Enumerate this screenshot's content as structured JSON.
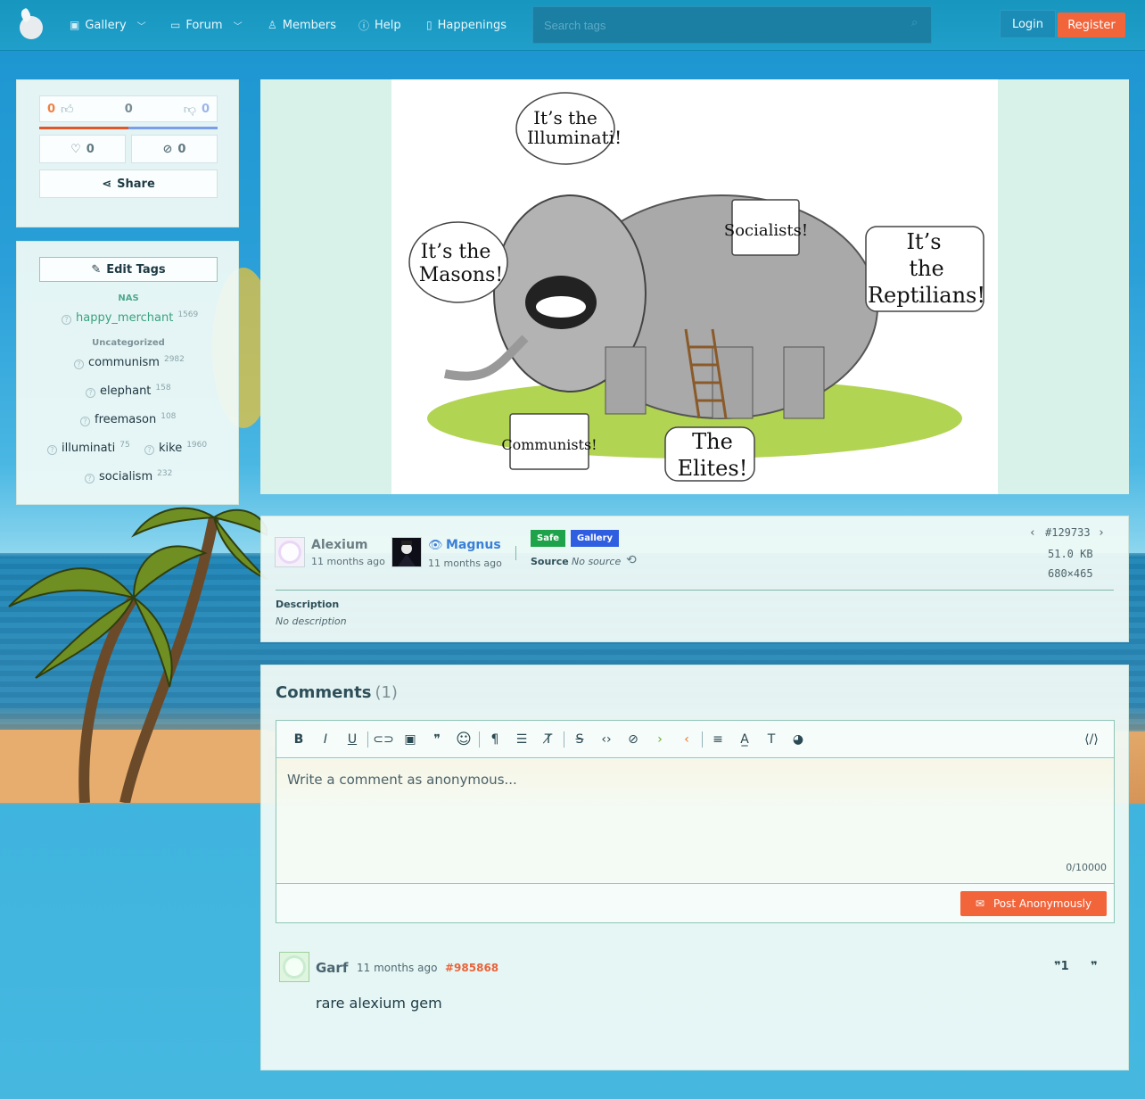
{
  "nav": {
    "logo_icon": "onion-logo-icon",
    "items": [
      {
        "label": "Gallery",
        "icon": "image-icon"
      },
      {
        "label": "Forum",
        "icon": "chat-icon"
      },
      {
        "label": "Members",
        "icon": "user-icon"
      },
      {
        "label": "Help",
        "icon": "question-icon"
      },
      {
        "label": "Happenings",
        "icon": "book-icon"
      }
    ],
    "search_placeholder": "Search tags",
    "login_label": "Login",
    "register_label": "Register",
    "accent_color": "#f2643a"
  },
  "votes": {
    "upvotes": "0",
    "score": "0",
    "downvotes": "0",
    "favorites": "0",
    "hides": "0",
    "share_label": "Share"
  },
  "tags": {
    "edit_label": "Edit Tags",
    "categories": [
      {
        "label": "NAS",
        "items": [
          {
            "name": "happy_merchant",
            "count": "1569"
          }
        ]
      },
      {
        "label": "Uncategorized",
        "items": [
          {
            "name": "communism",
            "count": "2982"
          },
          {
            "name": "elephant",
            "count": "158"
          },
          {
            "name": "freemason",
            "count": "108"
          },
          {
            "name": "illuminati",
            "count": "75"
          },
          {
            "name": "kike",
            "count": "1960"
          },
          {
            "name": "socialism",
            "count": "232"
          }
        ]
      }
    ]
  },
  "image": {
    "bubbles": {
      "illuminati": "It’s the\nIlluminati!",
      "socialists": "Socialists!",
      "masons": "It’s the\nMasons!",
      "reptilians": "It’s\nthe\nReptilians!",
      "communists": "Communists!",
      "elites": "The\nElites!"
    }
  },
  "info": {
    "uploader": "Alexium",
    "uploader_time": "11 months ago",
    "approver": "Magnus",
    "approver_time": "11 months ago",
    "rating_badge": "Safe",
    "category_badge": "Gallery",
    "safe_color": "#1fa34a",
    "gallery_color": "#2f5fe0",
    "source_label": "Source",
    "source_value": "No source",
    "image_id": "#129733",
    "file_size": "51.0 KB",
    "dimensions": "680×465",
    "description_label": "Description",
    "description_value": "No description"
  },
  "comments": {
    "title": "Comments",
    "count": "(1)",
    "placeholder": "Write a comment as anonymous...",
    "char_count": "0/10000",
    "post_label": "Post Anonymously",
    "toolbar": [
      "bold-icon",
      "italic-icon",
      "underline-icon",
      "link-icon",
      "image-icon",
      "quote-icon",
      "emoji-icon",
      "paragraph-icon",
      "list-icon",
      "clear-format-icon",
      "strikethrough-icon",
      "code-icon",
      "spoiler-icon",
      "greentext-icon",
      "orangetext-icon",
      "align-icon",
      "text-color-icon",
      "font-size-icon",
      "palette-icon",
      "source-code-icon"
    ],
    "items": [
      {
        "author": "Garf",
        "time": "11 months ago",
        "id": "#985868",
        "body": "rare alexium gem"
      }
    ]
  }
}
